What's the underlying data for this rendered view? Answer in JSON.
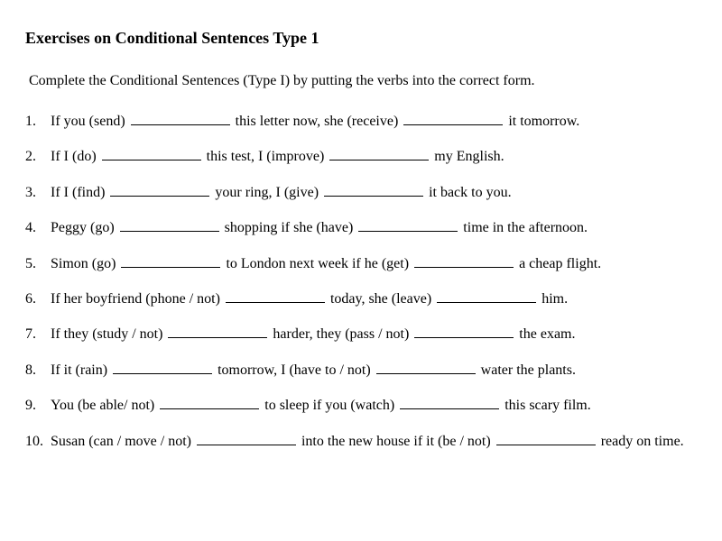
{
  "title": "Exercises on Conditional Sentences Type 1",
  "instruction": "Complete the Conditional Sentences (Type I) by putting the verbs into the correct form.",
  "exercises": [
    {
      "number": "1.",
      "parts": [
        "If you (send) ",
        "BLANK",
        " this letter now, she (receive) ",
        "BLANK",
        " it tomorrow."
      ]
    },
    {
      "number": "2.",
      "parts": [
        "If I (do) ",
        "BLANK",
        "  this test, I (improve) ",
        "BLANK",
        "  my English."
      ]
    },
    {
      "number": "3.",
      "parts": [
        "If I (find) ",
        "BLANK",
        "  your ring, I (give) ",
        "BLANK",
        "  it back to you."
      ]
    },
    {
      "number": "4.",
      "parts": [
        "Peggy (go) ",
        "BLANK",
        "  shopping if she (have) ",
        "BLANK",
        "  time in the afternoon."
      ]
    },
    {
      "number": "5.",
      "parts": [
        "Simon (go) ",
        "BLANK",
        "  to London next week if he (get) ",
        "BLANK",
        "  a cheap flight."
      ]
    },
    {
      "number": "6.",
      "parts": [
        "If her boyfriend (phone / not) ",
        "BLANK",
        "  today, she (leave) ",
        "BLANK",
        "  him."
      ]
    },
    {
      "number": "7.",
      "parts": [
        "If they (study / not) ",
        "BLANK",
        "  harder, they (pass / not) ",
        "BLANK",
        "  the exam."
      ]
    },
    {
      "number": "8.",
      "parts": [
        "If it (rain) ",
        "BLANK",
        "  tomorrow, I (have to / not) ",
        "BLANK",
        "  water the plants."
      ]
    },
    {
      "number": "9.",
      "parts": [
        "You (be able/ not) ",
        "BLANK",
        "  to sleep if you (watch) ",
        "BLANK",
        "  this scary film."
      ]
    },
    {
      "number": "10.",
      "parts": [
        "Susan (can / move / not) ",
        "BLANK",
        "  into the new house if it (be / not) ",
        "BLANK",
        "  ready on time."
      ]
    }
  ]
}
